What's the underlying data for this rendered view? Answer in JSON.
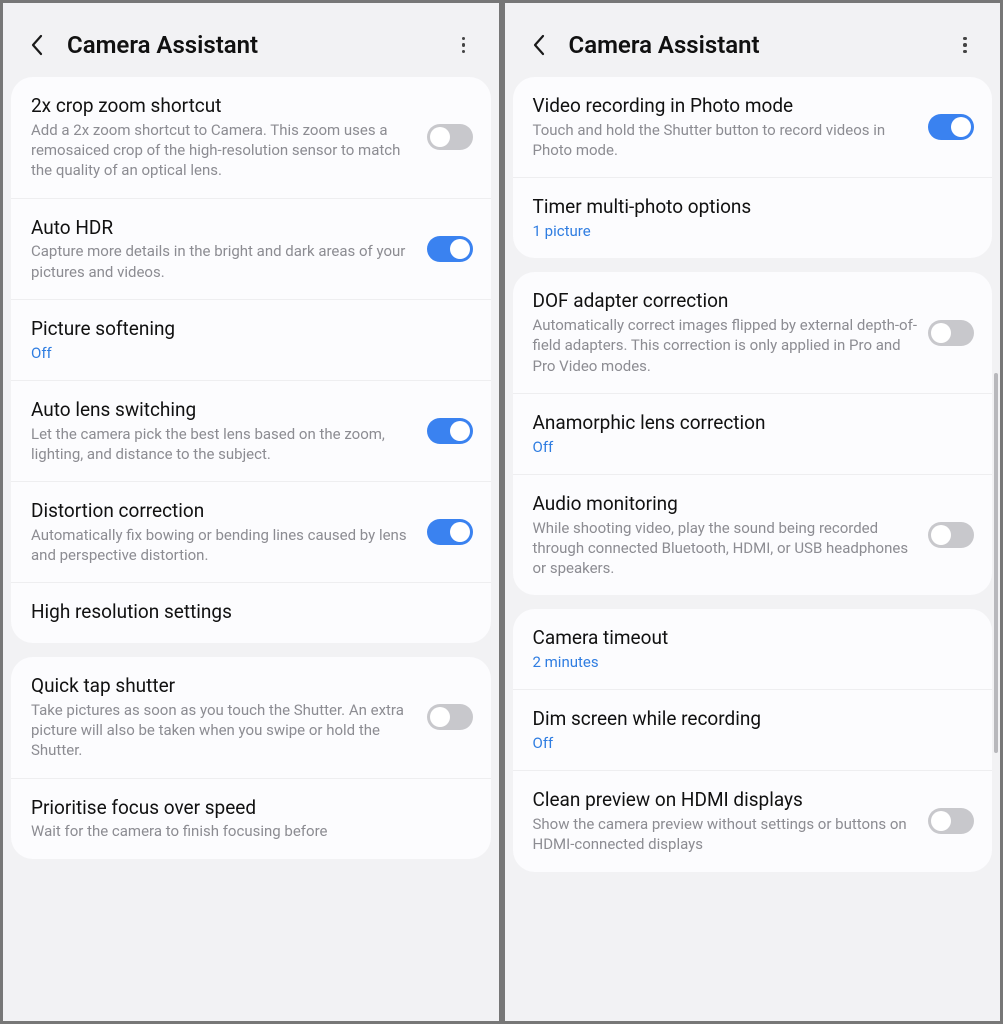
{
  "left": {
    "title": "Camera Assistant",
    "groups": [
      {
        "rows": [
          {
            "title": "2x crop zoom shortcut",
            "desc": "Add a 2x zoom shortcut to Camera. This zoom uses a remosaiced crop of the high-resolution sensor to match the quality of an optical lens.",
            "toggle": false
          },
          {
            "title": "Auto HDR",
            "desc": "Capture more details in the bright and dark areas of your pictures and videos.",
            "toggle": true
          },
          {
            "title": "Picture softening",
            "value": "Off"
          },
          {
            "title": "Auto lens switching",
            "desc": "Let the camera pick the best lens based on the zoom, lighting, and distance to the subject.",
            "toggle": true
          },
          {
            "title": "Distortion correction",
            "desc": "Automatically fix bowing or bending lines caused by lens and perspective distortion.",
            "toggle": true
          },
          {
            "title": "High resolution settings"
          }
        ]
      },
      {
        "rows": [
          {
            "title": "Quick tap shutter",
            "desc": "Take pictures as soon as you touch the Shutter. An extra picture will also be taken when you swipe or hold the Shutter.",
            "toggle": false
          },
          {
            "title": "Prioritise focus over speed",
            "desc": "Wait for the camera to finish focusing before"
          }
        ]
      }
    ]
  },
  "right": {
    "title": "Camera Assistant",
    "groups": [
      {
        "rows": [
          {
            "title": "Video recording in Photo mode",
            "desc": "Touch and hold the Shutter button to record videos in Photo mode.",
            "toggle": true
          },
          {
            "title": "Timer multi-photo options",
            "value": "1 picture"
          }
        ]
      },
      {
        "rows": [
          {
            "title": "DOF adapter correction",
            "desc": "Automatically correct images flipped by external depth-of-field adapters. This correction is only applied in Pro and Pro Video modes.",
            "toggle": false
          },
          {
            "title": "Anamorphic lens correction",
            "value": "Off"
          },
          {
            "title": "Audio monitoring",
            "desc": "While shooting video, play the sound being recorded through connected Bluetooth, HDMI, or USB headphones or speakers.",
            "toggle": false
          }
        ]
      },
      {
        "rows": [
          {
            "title": "Camera timeout",
            "value": "2 minutes"
          },
          {
            "title": "Dim screen while recording",
            "value": "Off"
          },
          {
            "title": "Clean preview on HDMI displays",
            "desc": "Show the camera preview without settings or buttons on HDMI-connected displays",
            "toggle": false
          }
        ]
      }
    ]
  }
}
